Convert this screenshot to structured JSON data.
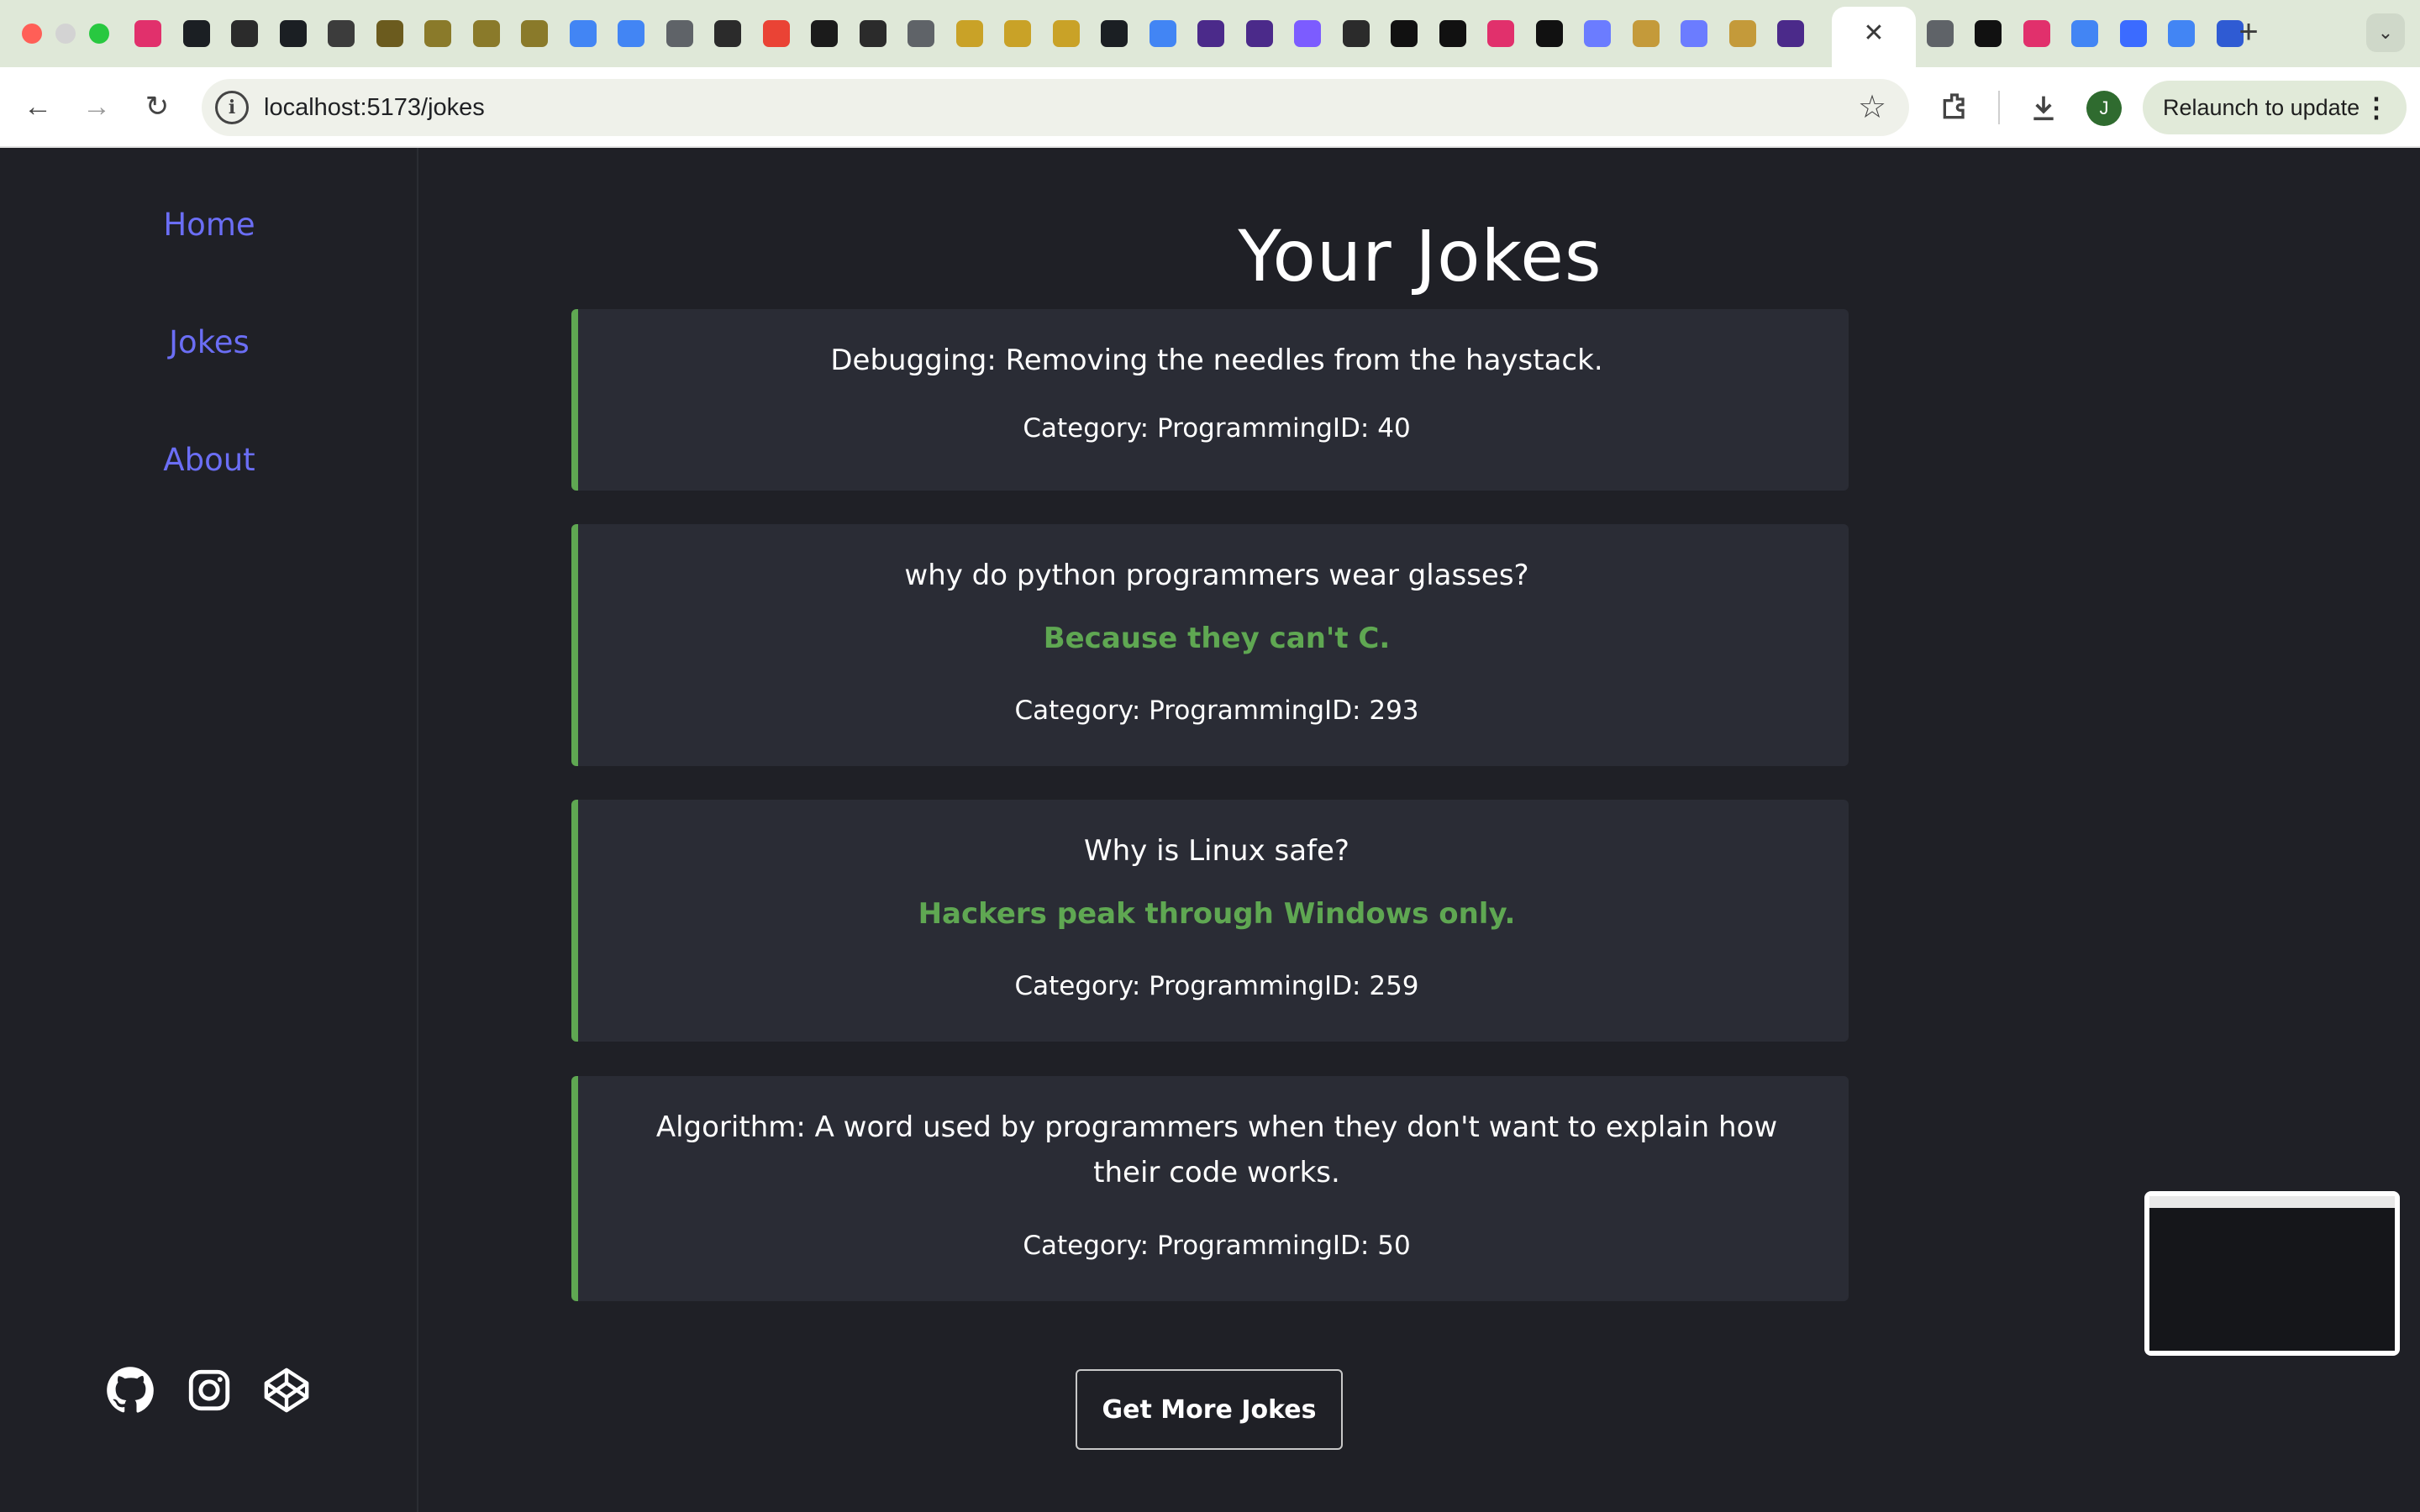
{
  "browser": {
    "url_host": "localhost:5173",
    "url_path": "/jokes",
    "relaunch_label": "Relaunch to update",
    "avatar_initial": "J",
    "tab_icon_colors": [
      "#e1306c",
      "#1b1f23",
      "#2b2b2b",
      "#1b1f23",
      "#3c3c3c",
      "#6b5b1e",
      "#8a7a2a",
      "#8a7a2a",
      "#8a7a2a",
      "#4285f4",
      "#4285f4",
      "#5f6368",
      "#2b2b2b",
      "#ea4335",
      "#1b1b1b",
      "#2b2b2b",
      "#5f6368",
      "#c9a227",
      "#c9a227",
      "#c9a227",
      "#1b1f23",
      "#4285f4",
      "#4b2a8a",
      "#4b2a8a",
      "#7c5cff",
      "#2b2b2b",
      "#111111",
      "#111111",
      "#e1306c",
      "#111111",
      "#6b7cff",
      "#c49a3a",
      "#6b7cff",
      "#c49a3a",
      "#4b2a8a",
      "#5f6368",
      "#111111",
      "#e1306c",
      "#4285f4",
      "#3b6bff",
      "#4285f4",
      "#2f5bd3"
    ]
  },
  "nav": {
    "home": "Home",
    "jokes": "Jokes",
    "about": "About"
  },
  "page": {
    "title": "Your Jokes",
    "more_button": "Get More Jokes"
  },
  "jokes": [
    {
      "setup": "Debugging: Removing the needles from the haystack.",
      "delivery": "",
      "meta": "Category: ProgrammingID: 40"
    },
    {
      "setup": "why do python programmers wear glasses?",
      "delivery": "Because they can't C.",
      "meta": "Category: ProgrammingID: 293"
    },
    {
      "setup": "Why is Linux safe?",
      "delivery": "Hackers peak through Windows only.",
      "meta": "Category: ProgrammingID: 259"
    },
    {
      "setup": "Algorithm: A word used by programmers when they don't want to explain how their code works.",
      "delivery": "",
      "meta": "Category: ProgrammingID: 50"
    }
  ],
  "social_icons": [
    "github-icon",
    "instagram-icon",
    "codepen-icon"
  ],
  "colors": {
    "accent_link": "#6b6ef5",
    "punchline_green": "#5fa752",
    "card_bg": "#2a2c35",
    "page_bg": "#1f2026"
  }
}
